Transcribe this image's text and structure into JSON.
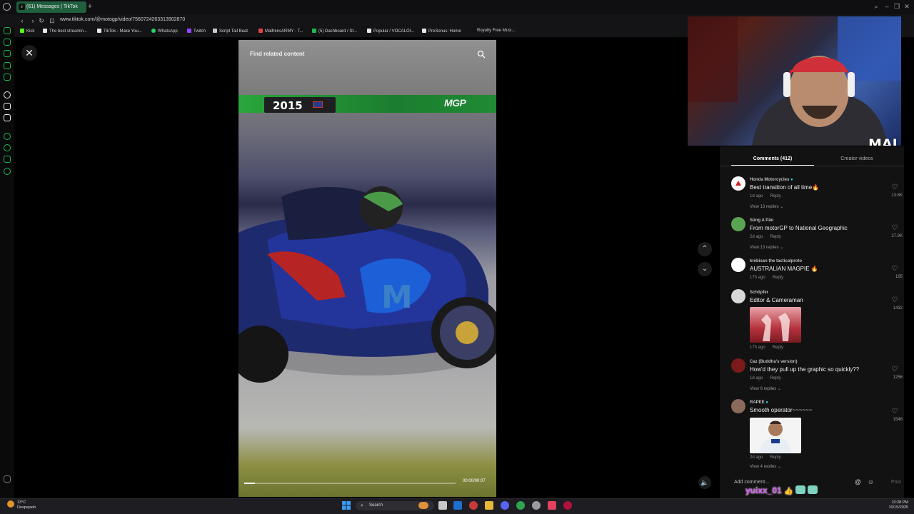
{
  "browser": {
    "tab_title": "(61) Messages | TikTok",
    "tab_icon": "tiktok-icon",
    "new_tab_label": "+",
    "url": "www.tiktok.com/@motogp/video/7560724263313902870",
    "bookmarks": [
      {
        "label": "Kick",
        "color": "#53fc18"
      },
      {
        "label": "The best streamin...",
        "color": "#e8e8e8"
      },
      {
        "label": "TikTok - Make You...",
        "color": "#e8e8e8"
      },
      {
        "label": "WhatsApp",
        "color": "#25d366"
      },
      {
        "label": "Twitch",
        "color": "#9146ff"
      },
      {
        "label": "Script Tail Beat",
        "color": "#cccccc"
      },
      {
        "label": "MaifrensARMY - T...",
        "color": "#d44"
      },
      {
        "label": "(5) Dashboard / St...",
        "color": "#1db954"
      },
      {
        "label": "Popular / VOCALOI...",
        "color": "#e8e8e8"
      },
      {
        "label": "PreSonus: Home",
        "color": "#e8e8e8"
      },
      {
        "label": "Royalty Free Musi...",
        "color": "#e8e8e8"
      }
    ]
  },
  "video": {
    "find_related": "Find related content",
    "year_badge": "2015",
    "brand": "MGP",
    "time": "00:00/00:07",
    "progress": 0.05
  },
  "webcam": {
    "overlay_text": "MAI"
  },
  "comments_panel": {
    "tab_comments": "Comments (412)",
    "tab_creator": "Creator videos",
    "add_comment_placeholder": "Add comment...",
    "post_label": "Post",
    "comments": [
      {
        "user": "Honda Motorcycles",
        "text": "Best transition of all time🔥",
        "age": "1d ago",
        "reply": "Reply",
        "likes": "13.6K",
        "view_replies": "View 13 replies ⌄",
        "avatar_color": "#ffffff"
      },
      {
        "user": "Sūng A Pão",
        "text": "From motorGP to National Geographic",
        "age": "2d ago",
        "reply": "Reply",
        "likes": "27.9K",
        "view_replies": "View 13 replies ⌄",
        "avatar_color": "#5aa352"
      },
      {
        "user": "krebisan the tacticalproto",
        "text": "AUSTRALIAN MAGPIE 🔥",
        "age": "17h ago",
        "reply": "Reply",
        "likes": "195",
        "view_replies": "",
        "avatar_color": "#ffffff"
      },
      {
        "user": "Schöpfer",
        "text": "Editor & Cameraman",
        "age": "17h ago",
        "reply": "Reply",
        "likes": "1432",
        "view_replies": "",
        "avatar_color": "#d8d8d8"
      },
      {
        "user": "Caz (Buddha's version)",
        "text": "How'd they pull up the graphic so quickly??",
        "age": "1d ago",
        "reply": "Reply",
        "likes": "1256",
        "view_replies": "View 6 replies ⌄",
        "avatar_color": "#7a1a1a"
      },
      {
        "user": "RAPEE",
        "text": "Smooth operator~~~~~~",
        "age": "2d ago",
        "reply": "Reply",
        "likes": "1548",
        "view_replies": "View 4 replies ⌄",
        "avatar_color": "#8a6a5a"
      }
    ]
  },
  "overlay": {
    "chat_user": "yuixx_01"
  },
  "taskbar": {
    "weather_temp": "13°C",
    "weather_desc": "Despejado",
    "search_label": "Search",
    "time": "10:28 PM",
    "date": "10/15/2025"
  }
}
